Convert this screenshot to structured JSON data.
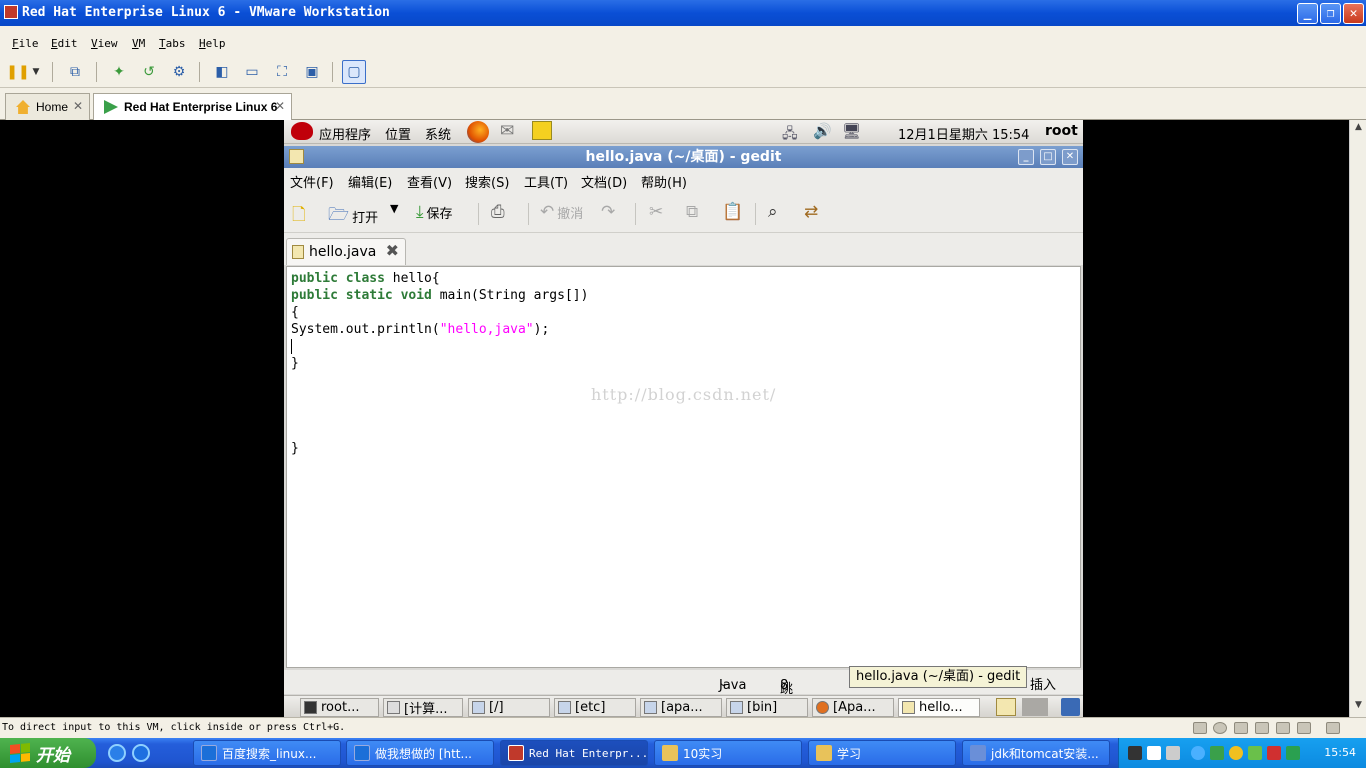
{
  "vmware": {
    "title": "Red Hat Enterprise Linux 6 - VMware Workstation",
    "menu": [
      "File",
      "Edit",
      "View",
      "VM",
      "Tabs",
      "Help"
    ],
    "tabs": [
      {
        "label": "Home"
      },
      {
        "label": "Red Hat Enterprise Linux 6"
      }
    ],
    "status_message": "To direct input to this VM, click inside or press Ctrl+G."
  },
  "gnome_panel": {
    "applications": "应用程序",
    "places": "位置",
    "system": "系统",
    "clock": "12月1日星期六 15:54",
    "user": "root"
  },
  "gedit": {
    "title": "hello.java (~/桌面) - gedit",
    "menu": [
      "文件(F)",
      "编辑(E)",
      "查看(V)",
      "搜索(S)",
      "工具(T)",
      "文档(D)",
      "帮助(H)"
    ],
    "toolbar": {
      "open_label": "打开",
      "save_label": "保存",
      "undo_label": "撤消"
    },
    "tab_label": "hello.java",
    "code": {
      "line1_kw": "public class",
      "line1_rest": " hello{",
      "line2_kw": "public static void",
      "line2_rest": " main(String args[])",
      "line3": "{",
      "line4_pre": "System.out.println(",
      "line4_str": "\"hello,java\"",
      "line4_post": ");",
      "line6": "}",
      "line11": "}"
    },
    "watermark": "http://blog.csdn.net/",
    "status": {
      "language": "Java",
      "tab_width_label": "跳格宽度:",
      "tab_width_value": "8",
      "insert_mode": "插入"
    },
    "tooltip": "hello.java (~/桌面) - gedit"
  },
  "guest_taskbar": [
    "root...",
    "[计算...",
    "[/]",
    "[etc]",
    "[apa...",
    "[bin]",
    "[Apa...",
    "hello..."
  ],
  "xp_taskbar": {
    "start_label": "开始",
    "tasks": [
      {
        "label": "百度搜索_linux...",
        "color": "#1b6fd8"
      },
      {
        "label": "做我想做的 [htt...",
        "color": "#1b6fd8"
      },
      {
        "label": "Red Hat Enterpr...",
        "color": "#c0392b"
      },
      {
        "label": "10实习",
        "color": "#e8c25a"
      },
      {
        "label": "学习",
        "color": "#e8c25a"
      },
      {
        "label": "jdk和tomcat安装...",
        "color": "#6a8fd8"
      }
    ],
    "clock": "15:54"
  }
}
